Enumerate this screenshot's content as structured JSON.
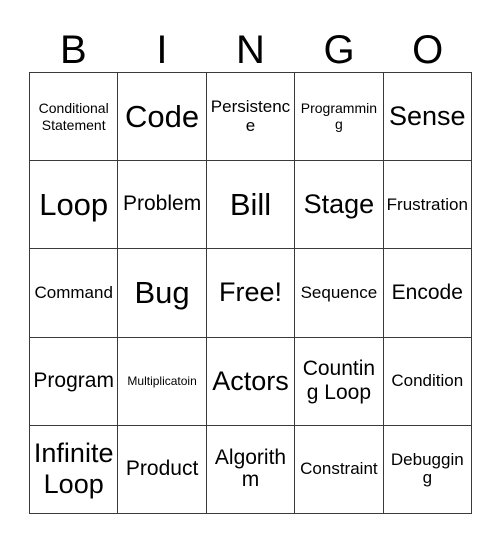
{
  "card": {
    "header_letters": [
      "B",
      "I",
      "N",
      "G",
      "O"
    ],
    "columns": 5,
    "rows": 5,
    "grid_line_color": "#3a3a3a",
    "background_color": "#ffffff",
    "text_color": "#000000",
    "cells": [
      {
        "text": "Conditional Statement",
        "size": "xs",
        "free": false
      },
      {
        "text": "Code",
        "size": "xl",
        "free": false
      },
      {
        "text": "Persistence",
        "size": "sm",
        "free": false
      },
      {
        "text": "Programming",
        "size": "xs",
        "free": false
      },
      {
        "text": "Sense",
        "size": "lg",
        "free": false
      },
      {
        "text": "Loop",
        "size": "xl",
        "free": false
      },
      {
        "text": "Problem",
        "size": "md",
        "free": false
      },
      {
        "text": "Bill",
        "size": "xl",
        "free": false
      },
      {
        "text": "Stage",
        "size": "lg",
        "free": false
      },
      {
        "text": "Frustration",
        "size": "sm",
        "free": false
      },
      {
        "text": "Command",
        "size": "sm",
        "free": false
      },
      {
        "text": "Bug",
        "size": "xl",
        "free": false
      },
      {
        "text": "Free!",
        "size": "lg",
        "free": true
      },
      {
        "text": "Sequence",
        "size": "sm",
        "free": false
      },
      {
        "text": "Encode",
        "size": "md",
        "free": false
      },
      {
        "text": "Program",
        "size": "md",
        "free": false
      },
      {
        "text": "Multiplicatoin",
        "size": "xxs",
        "free": false
      },
      {
        "text": "Actors",
        "size": "lg",
        "free": false
      },
      {
        "text": "Counting Loop",
        "size": "md",
        "free": false
      },
      {
        "text": "Condition",
        "size": "sm",
        "free": false
      },
      {
        "text": "Infinite Loop",
        "size": "lg",
        "free": false
      },
      {
        "text": "Product",
        "size": "md",
        "free": false
      },
      {
        "text": "Algorithm",
        "size": "md",
        "free": false
      },
      {
        "text": "Constraint",
        "size": "sm",
        "free": false
      },
      {
        "text": "Debugging",
        "size": "sm",
        "free": false
      }
    ]
  }
}
